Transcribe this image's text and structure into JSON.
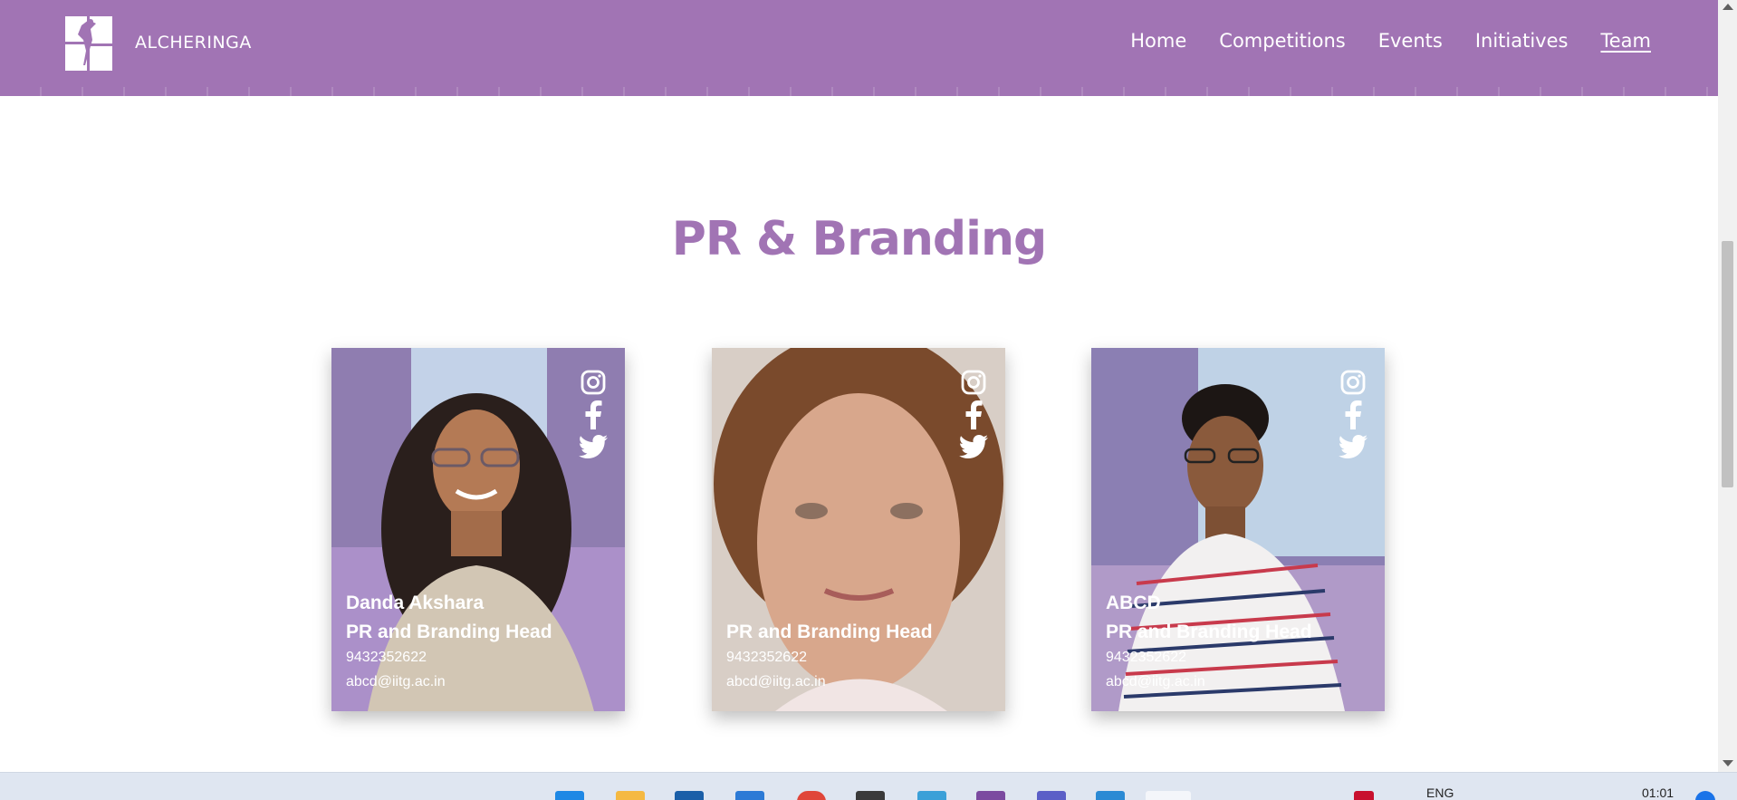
{
  "header": {
    "brand": "ALCHERINGA",
    "nav": [
      {
        "label": "Home",
        "active": false
      },
      {
        "label": "Competitions",
        "active": false
      },
      {
        "label": "Events",
        "active": false
      },
      {
        "label": "Initiatives",
        "active": false
      },
      {
        "label": "Team",
        "active": true
      }
    ],
    "color": "#a174b4"
  },
  "section": {
    "title": "PR & Branding"
  },
  "cards": [
    {
      "name": "Danda Akshara",
      "role": "PR and Branding Head",
      "phone": "9432352622",
      "email": "abcd@iitg.ac.in",
      "socials": [
        "instagram-icon",
        "facebook-icon",
        "twitter-icon"
      ]
    },
    {
      "name": "",
      "role": "PR and Branding Head",
      "phone": "9432352622",
      "email": "abcd@iitg.ac.in",
      "socials": [
        "instagram-icon",
        "facebook-icon",
        "twitter-icon"
      ]
    },
    {
      "name": "ABCD",
      "role": "PR and Branding Head",
      "phone": "9432352622",
      "email": "abcd@iitg.ac.in",
      "socials": [
        "instagram-icon",
        "facebook-icon",
        "twitter-icon"
      ]
    }
  ],
  "taskbar": {
    "language": "ENG",
    "time": "01:01"
  }
}
